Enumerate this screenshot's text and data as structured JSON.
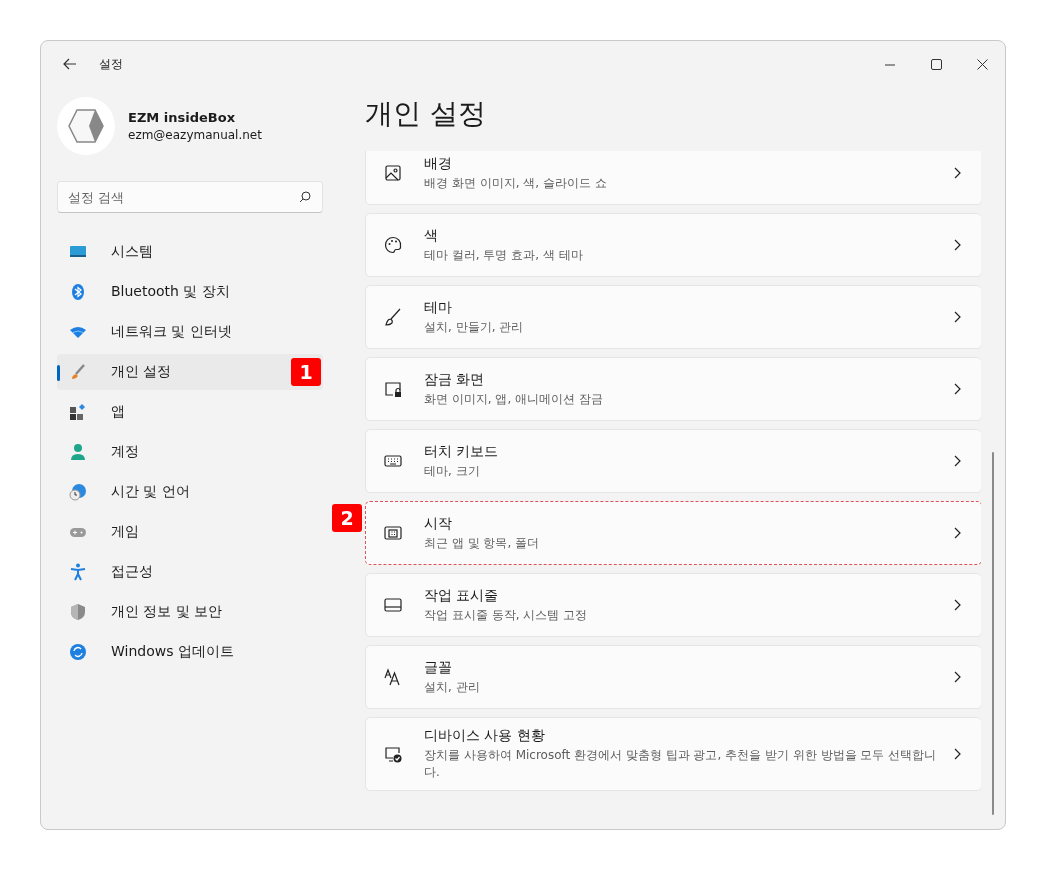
{
  "window": {
    "title": "설정"
  },
  "profile": {
    "name": "EZM insideBox",
    "email": "ezm@eazymanual.net"
  },
  "search": {
    "placeholder": "설정 검색"
  },
  "sidebar": {
    "items": [
      {
        "label": "시스템",
        "selected": false
      },
      {
        "label": "Bluetooth 및 장치",
        "selected": false
      },
      {
        "label": "네트워크 및 인터넷",
        "selected": false
      },
      {
        "label": "개인 설정",
        "selected": true,
        "callout": "1"
      },
      {
        "label": "앱",
        "selected": false
      },
      {
        "label": "계정",
        "selected": false
      },
      {
        "label": "시간 및 언어",
        "selected": false
      },
      {
        "label": "게임",
        "selected": false
      },
      {
        "label": "접근성",
        "selected": false
      },
      {
        "label": "개인 정보 및 보안",
        "selected": false
      },
      {
        "label": "Windows 업데이트",
        "selected": false
      }
    ]
  },
  "page": {
    "title": "개인 설정"
  },
  "cards": [
    {
      "title": "배경",
      "description": "배경 화면 이미지, 색, 슬라이드 쇼",
      "highlighted": false
    },
    {
      "title": "색",
      "description": "테마 컬러, 투명 효과, 색 테마",
      "highlighted": false
    },
    {
      "title": "테마",
      "description": "설치, 만들기, 관리",
      "highlighted": false
    },
    {
      "title": "잠금 화면",
      "description": "화면 이미지, 앱, 애니메이션 잠금",
      "highlighted": false
    },
    {
      "title": "터치 키보드",
      "description": "테마, 크기",
      "highlighted": false
    },
    {
      "title": "시작",
      "description": "최근 앱 및 항목, 폴더",
      "highlighted": true,
      "callout": "2"
    },
    {
      "title": "작업 표시줄",
      "description": "작업 표시줄 동작, 시스템 고정",
      "highlighted": false
    },
    {
      "title": "글꼴",
      "description": "설치, 관리",
      "highlighted": false
    },
    {
      "title": "디바이스 사용 현황",
      "description": "장치를 사용하여 Microsoft 환경에서 맞춤형 팁과 광고, 추천을 받기 위한 방법을 모두 선택합니다.",
      "highlighted": false
    }
  ]
}
